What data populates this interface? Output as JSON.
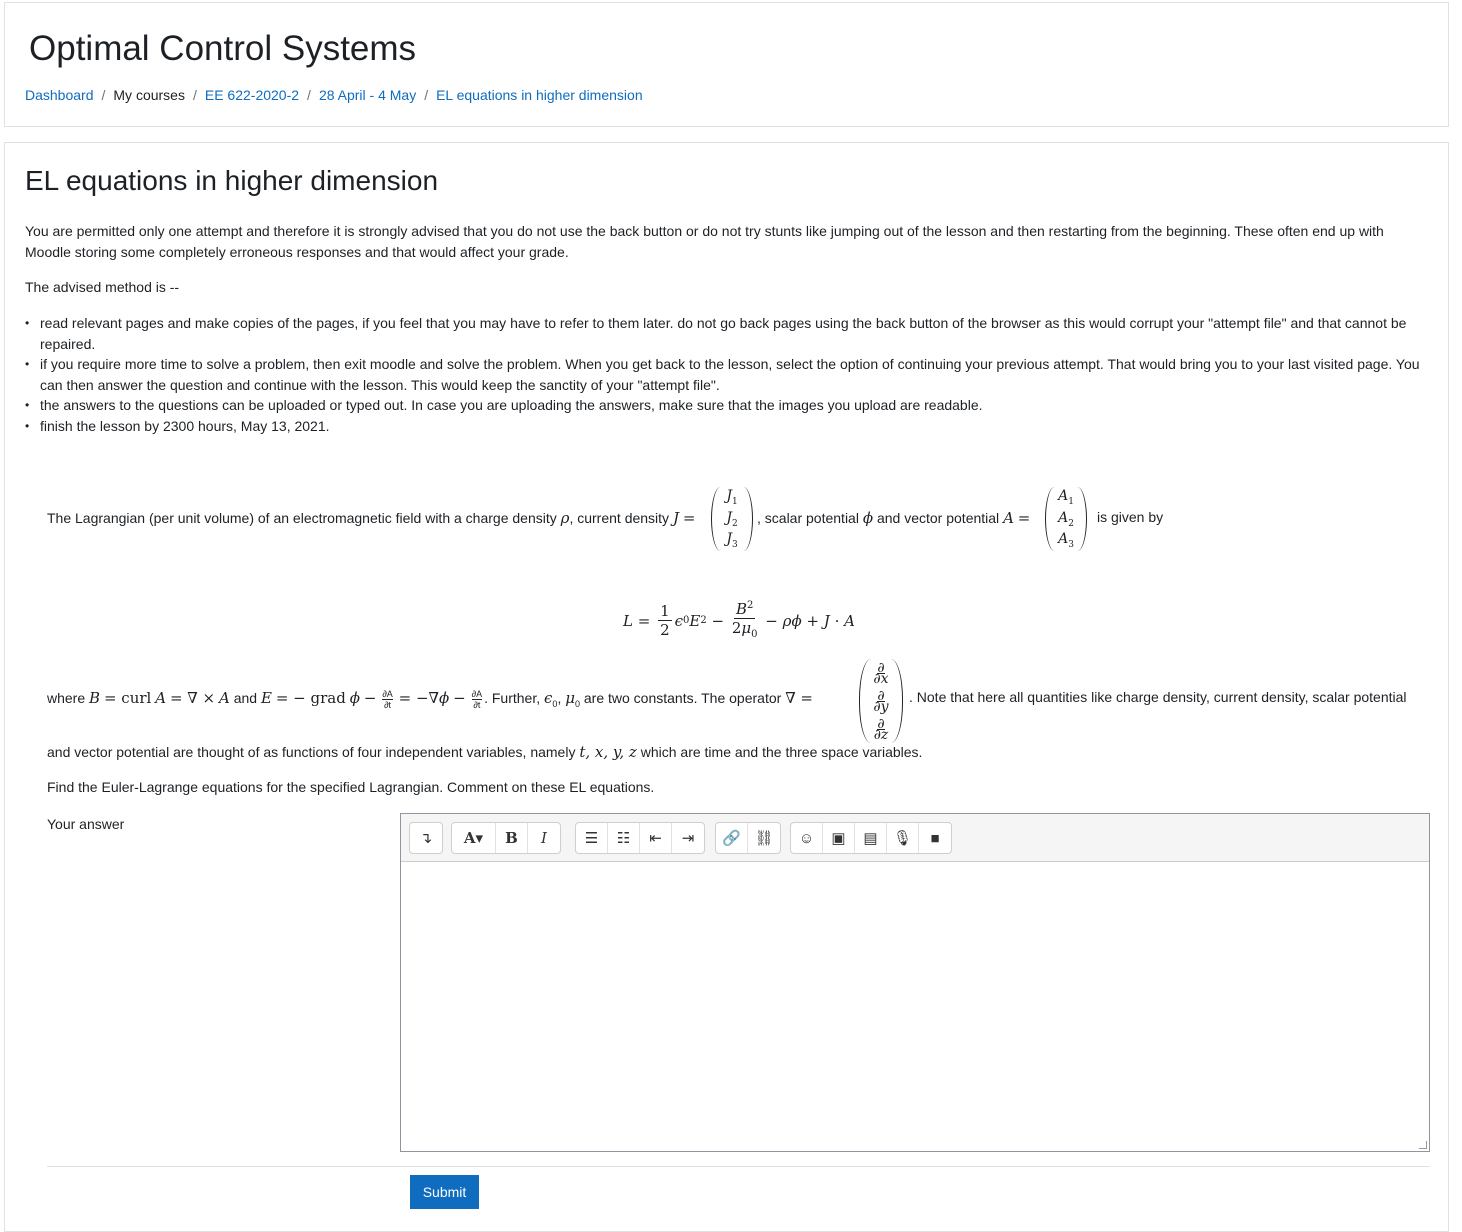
{
  "header": {
    "site_title": "Optimal Control Systems",
    "breadcrumb": [
      "Dashboard",
      "My courses",
      "EE 622-2020-2",
      "28 April - 4 May",
      "EL equations in higher dimension"
    ]
  },
  "lesson": {
    "title": "EL equations in higher dimension",
    "intro": "You are permitted only one attempt and therefore it is strongly advised that you do not use the back button or do not try stunts like jumping out of the lesson and then restarting from the beginning. These often end up with Moodle storing some completely erroneous responses and that would affect your grade.",
    "advised": "The advised method is --",
    "bullets": [
      "read relevant pages and make copies of the pages, if you feel that you may have to refer to them later. do not go back pages using the back button of the browser as this would corrupt your \"attempt file\" and that cannot be repaired.",
      "if you require more time to solve a problem, then exit moodle and solve the problem. When you get back to the lesson, select the option of continuing your previous attempt. That would bring you to your last visited page. You can then answer the question and continue with the lesson. This would keep the sanctity of your \"attempt file\".",
      "the answers to the questions can be uploaded or typed out. In case you are uploading the answers, make sure that the images you upload are readable.",
      "finish the lesson by 2300 hours, May 13, 2021."
    ]
  },
  "question": {
    "l1_a": "The Lagrangian (per unit volume) of an electromagnetic field with a charge density",
    "l1_b": ", current density",
    "l1_c": ", scalar potential",
    "l1_d": "and vector potential",
    "l1_e": "is given by",
    "J_vec": [
      "J1",
      "J2",
      "J3"
    ],
    "A_vec": [
      "A1",
      "A2",
      "A3"
    ],
    "l2_where": "where",
    "l2_and": "and",
    "l2_further": ". Further,",
    "l2_const": "are two constants. The operator",
    "l2_note": ". Note that here all quantities like charge density, current density, scalar potential",
    "l3_a": "and vector potential are thought of as functions of four independent variables, namely",
    "l3_b": "which are time and the three space variables.",
    "task": "Find the Euler-Lagrange equations for the specified Lagrangian. Comment on these EL equations.",
    "answer_label": "Your answer"
  },
  "toolbar": {
    "icons": [
      "collapse-icon",
      "font-style-icon",
      "bold-icon",
      "italic-icon",
      "unordered-list-icon",
      "ordered-list-icon",
      "outdent-icon",
      "indent-icon",
      "link-icon",
      "unlink-icon",
      "emoji-icon",
      "image-icon",
      "media-icon",
      "record-audio-icon",
      "record-video-icon"
    ]
  },
  "submit_label": "Submit",
  "colors": {
    "link": "#0f6cbf",
    "button": "#0f6cbf"
  }
}
